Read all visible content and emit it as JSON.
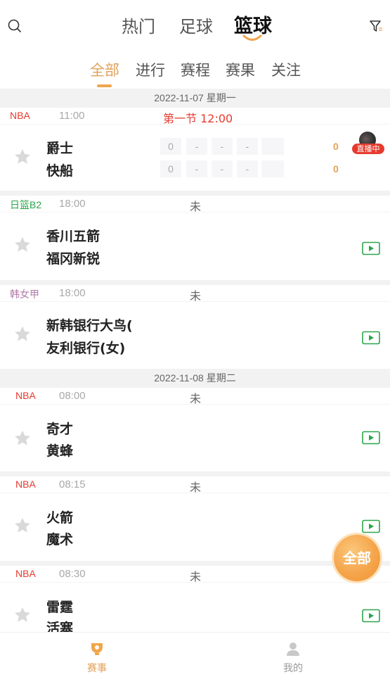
{
  "header": {
    "sport_tabs": [
      "热门",
      "足球",
      "篮球"
    ],
    "active_sport": "篮球"
  },
  "sub_tabs": [
    "全部",
    "进行",
    "赛程",
    "赛果",
    "关注"
  ],
  "active_sub_tab": "全部",
  "dates": [
    "2022-11-07 星期一",
    "2022-11-08 星期二"
  ],
  "matches": [
    {
      "league": "NBA",
      "league_color": "#e53a2e",
      "time": "11:00",
      "status": "第一节 12:00",
      "home": "爵士",
      "away": "快船",
      "home_scores": [
        "0",
        "-",
        "-",
        "-",
        ""
      ],
      "away_scores": [
        "0",
        "-",
        "-",
        "-",
        ""
      ],
      "home_total": "0",
      "away_total": "0",
      "live_label": "直播中"
    },
    {
      "league": "日篮B2",
      "league_color": "#2aa54a",
      "time": "18:00",
      "status": "未",
      "home": "香川五箭",
      "away": "福冈新锐"
    },
    {
      "league": "韩女甲",
      "league_color": "#b27aa8",
      "time": "18:00",
      "status": "未",
      "home": "新韩银行大鸟(",
      "away": "友利银行(女)"
    },
    {
      "league": "NBA",
      "league_color": "#e53a2e",
      "time": "08:00",
      "status": "未",
      "home": "奇才",
      "away": "黄蜂"
    },
    {
      "league": "NBA",
      "league_color": "#e53a2e",
      "time": "08:15",
      "status": "未",
      "home": "火箭",
      "away": "魔术"
    },
    {
      "league": "NBA",
      "league_color": "#e53a2e",
      "time": "08:30",
      "status": "未",
      "home": "雷霆",
      "away": "活塞"
    }
  ],
  "float_button": "全部",
  "bottom_nav": [
    {
      "label": "赛事",
      "icon": "trophy-icon",
      "active": true
    },
    {
      "label": "我的",
      "icon": "user-icon",
      "active": false
    }
  ],
  "colors": {
    "accent": "#e0a15a",
    "live": "#e53a2e",
    "video": "#2aa54a"
  }
}
